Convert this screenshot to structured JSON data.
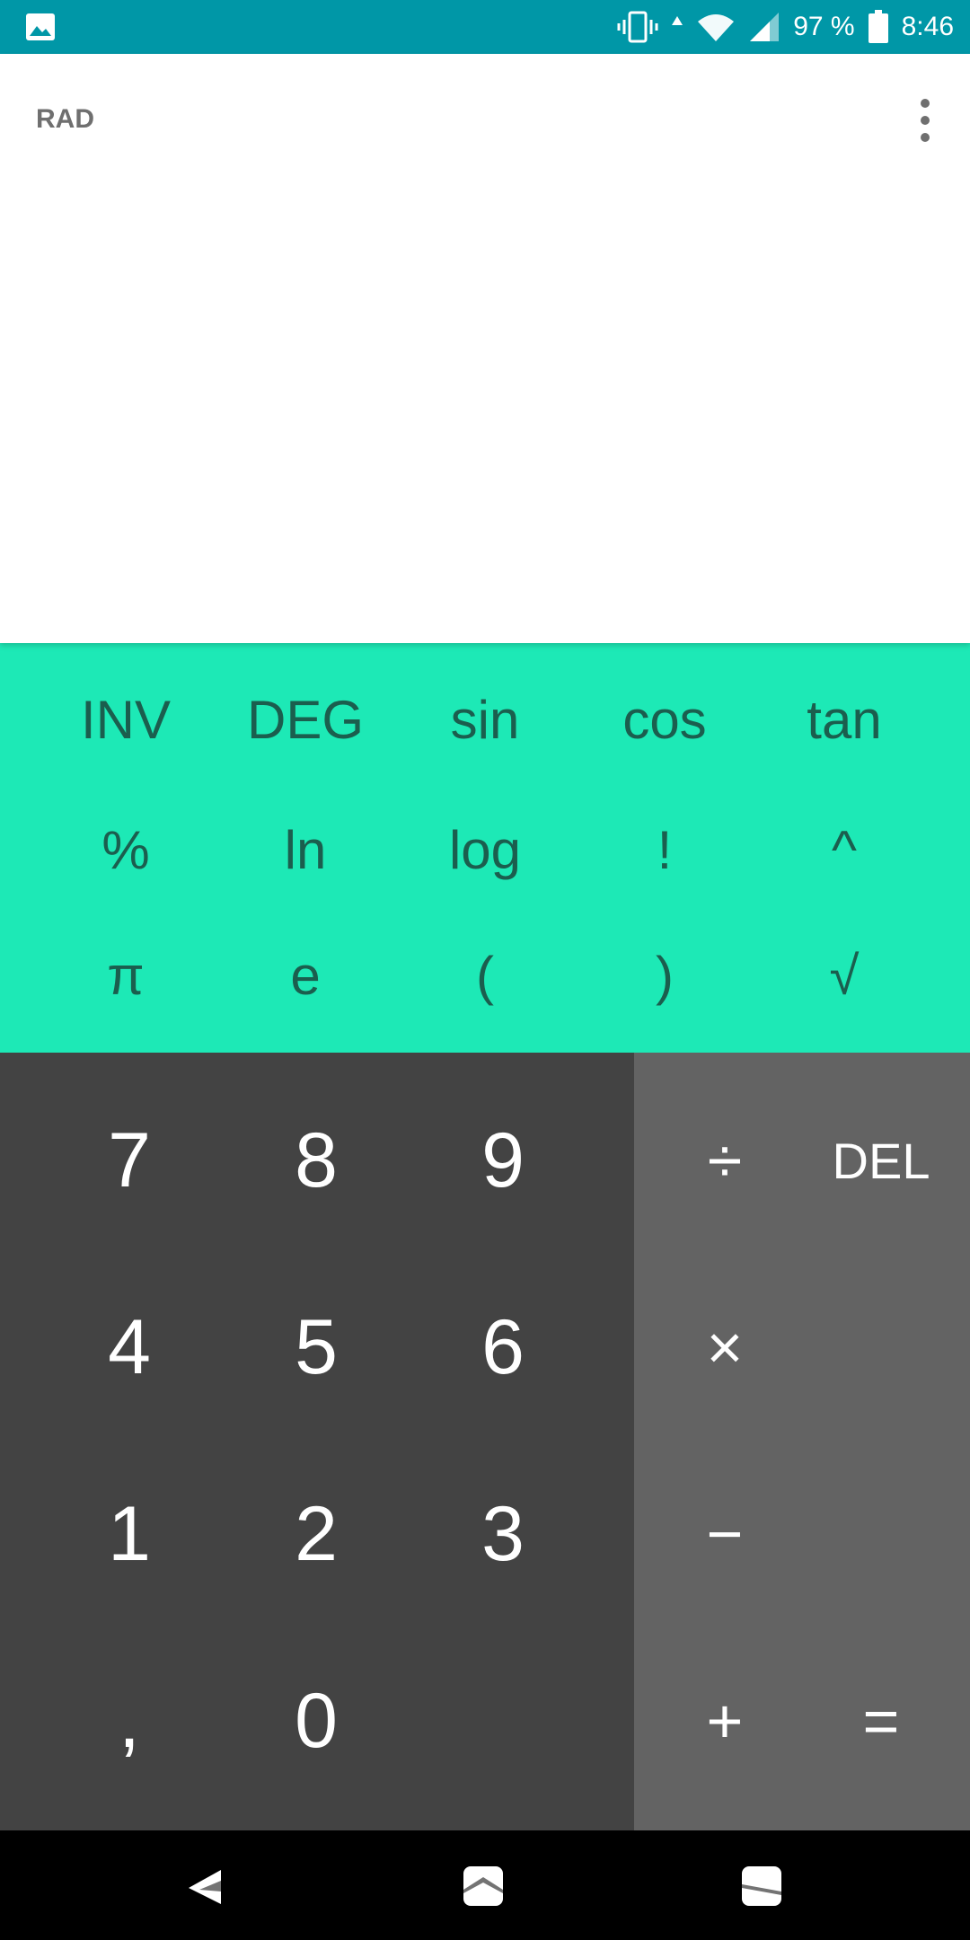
{
  "status_bar": {
    "battery_text": "97 %",
    "time": "8:46",
    "icons": [
      "gallery-icon",
      "vibrate-icon",
      "data-up-icon",
      "wifi-icon",
      "signal-icon",
      "battery-icon"
    ],
    "background": "#0097a7"
  },
  "display": {
    "mode": "RAD",
    "menu_icon": "more-vert-icon"
  },
  "advanced_pad": {
    "background": "#1de9b6",
    "keys": [
      "INV",
      "DEG",
      "sin",
      "cos",
      "tan",
      "%",
      "ln",
      "log",
      "!",
      "^",
      "π",
      "e",
      "(",
      ")",
      "√"
    ]
  },
  "numeric_pad": {
    "background": "#434343",
    "keys": [
      "7",
      "8",
      "9",
      "4",
      "5",
      "6",
      "1",
      "2",
      "3",
      ",",
      "0"
    ]
  },
  "operator_pad": {
    "background": "#636363",
    "keys": [
      "÷",
      "DEL",
      "×",
      "−",
      "+",
      "="
    ]
  },
  "nav_bar": {
    "icons": [
      "back-icon",
      "home-icon",
      "recents-icon"
    ]
  }
}
